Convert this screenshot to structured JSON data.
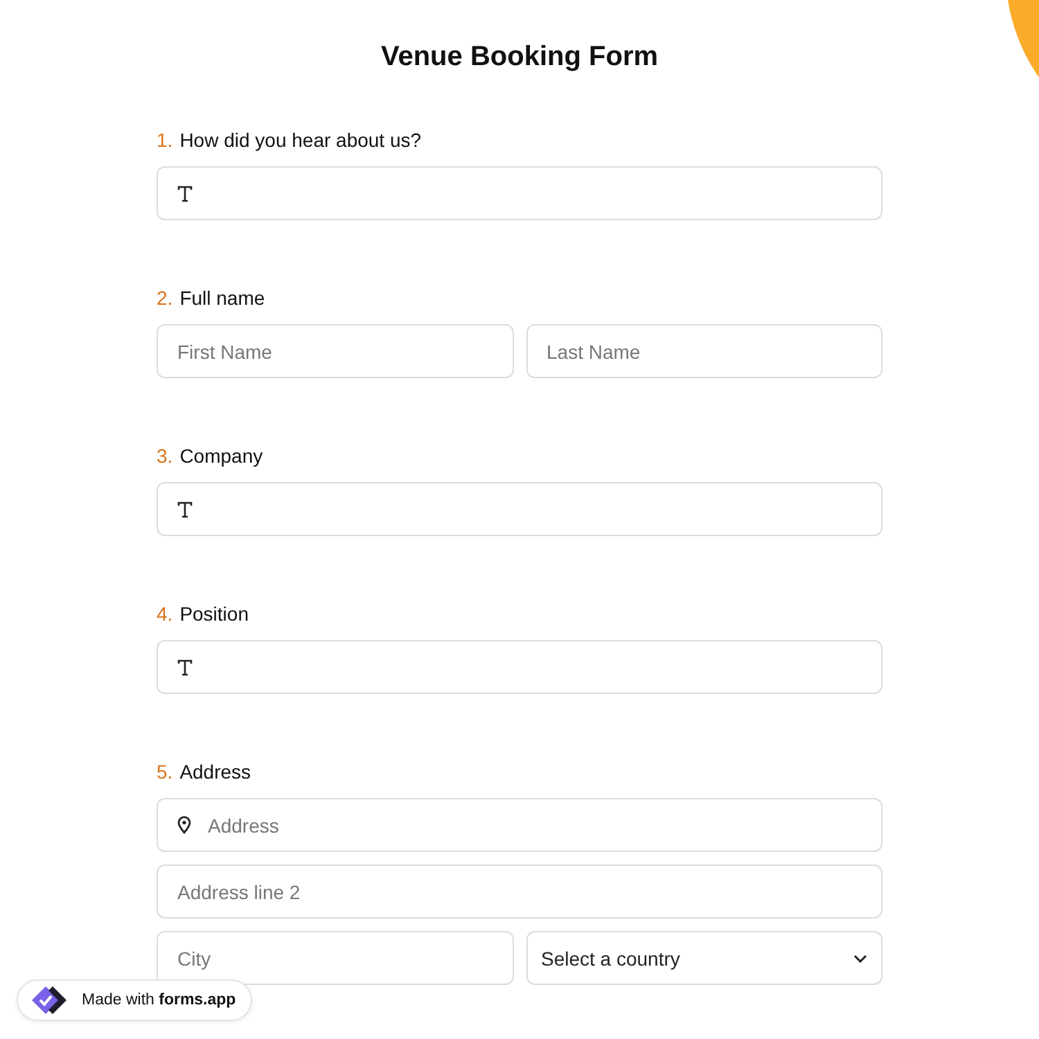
{
  "title": "Venue Booking Form",
  "questions": [
    {
      "number": "1.",
      "label": "How did you hear about us?",
      "fields": [
        {
          "kind": "text"
        }
      ]
    },
    {
      "number": "2.",
      "label": "Full name",
      "fields": [
        {
          "kind": "half",
          "placeholder": "First Name"
        },
        {
          "kind": "half",
          "placeholder": "Last Name"
        }
      ]
    },
    {
      "number": "3.",
      "label": "Company",
      "fields": [
        {
          "kind": "text"
        }
      ]
    },
    {
      "number": "4.",
      "label": "Position",
      "fields": [
        {
          "kind": "text"
        }
      ]
    },
    {
      "number": "5.",
      "label": "Address",
      "fields": [
        {
          "kind": "location",
          "placeholder": "Address"
        },
        {
          "kind": "full",
          "placeholder": "Address line 2"
        },
        {
          "kind": "half",
          "placeholder": "City"
        },
        {
          "kind": "select",
          "value": "Select a country"
        }
      ]
    }
  ],
  "badge": {
    "prefix": "Made with ",
    "brand": "forms.app"
  }
}
